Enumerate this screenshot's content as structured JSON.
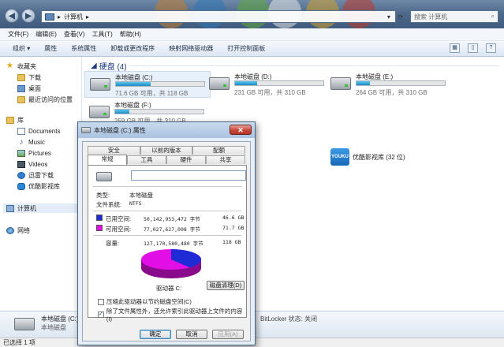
{
  "window": {
    "address_path": "计算机",
    "address_sep": "▸",
    "search_placeholder": "搜索 计算机",
    "back_glyph": "◀",
    "forward_glyph": "▶"
  },
  "menu": [
    "文件(F)",
    "编辑(E)",
    "查看(V)",
    "工具(T)",
    "帮助(H)"
  ],
  "toolbar": {
    "items": [
      "组织 ▾",
      "属性",
      "系统属性",
      "卸载或更改程序",
      "映射网络驱动器",
      "打开控制面板"
    ]
  },
  "sidebar": {
    "favorites": "收藏夹",
    "fav_items": [
      "下载",
      "桌面",
      "最近访问的位置"
    ],
    "libraries": "库",
    "lib_items": [
      "Documents",
      "Music",
      "Pictures",
      "Videos",
      "迅雷下载",
      "优酷影视库"
    ],
    "computer": "计算机",
    "network": "网络"
  },
  "content": {
    "group_title": "硬盘 (4)",
    "drives": [
      {
        "name": "本地磁盘 (C:)",
        "free": "71.6 GB 可用，共 118 GB",
        "used_fraction": 0.39
      },
      {
        "name": "本地磁盘 (D:)",
        "free": "231 GB 可用，共 310 GB",
        "used_fraction": 0.25
      },
      {
        "name": "本地磁盘 (E:)",
        "free": "264 GB 可用，共 310 GB",
        "used_fraction": 0.15
      },
      {
        "name": "本地磁盘 (F:)",
        "free": "259 GB 可用，共 310 GB",
        "used_fraction": 0.16
      }
    ],
    "youku_label": "优酷影视库 (32 位)",
    "youku_icon_text": "YOUKU"
  },
  "details": {
    "name": "本地磁盘 (C:)",
    "type": "本地磁盘",
    "bitlocker": "BitLocker 状态: 关闭"
  },
  "status": {
    "text": "已选择 1 项"
  },
  "dialog": {
    "title": "本地磁盘 (C:) 属性",
    "close": "✕",
    "tabs_row1": [
      "安全",
      "以前的版本",
      "配额"
    ],
    "tabs_row2": [
      "常规",
      "工具",
      "硬件",
      "共享"
    ],
    "name_value": "",
    "type_label": "类型:",
    "type_value": "本地磁盘",
    "fs_label": "文件系统:",
    "fs_value": "NTFS",
    "used_label": "已用空间:",
    "used_bytes": "50,142,953,472 字节",
    "used_gb": "46.6 GB",
    "free_label": "可用空间:",
    "free_bytes": "77,027,627,008 字节",
    "free_gb": "71.7 GB",
    "cap_label": "容量:",
    "cap_bytes": "127,170,580,480 字节",
    "cap_gb": "118 GB",
    "used_fraction": 0.394,
    "used_color": "#1f2bd6",
    "free_color": "#e20ee6",
    "drive_label": "驱动器 C:",
    "cleanup": "磁盘清理(D)",
    "compress": "压缩此驱动器以节约磁盘空间(C)",
    "index": "除了文件属性外，还允许索引此驱动器上文件的内容(I)",
    "ok": "确定",
    "cancel": "取消",
    "apply": "应用(A)"
  }
}
